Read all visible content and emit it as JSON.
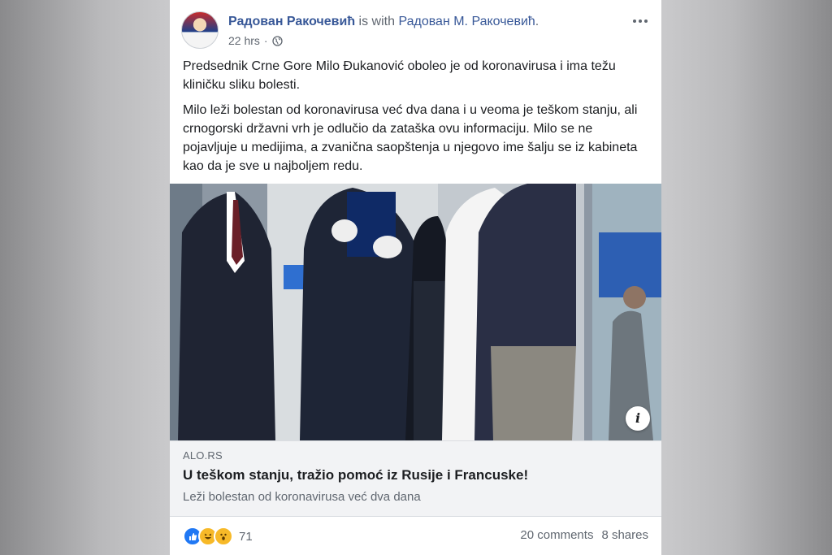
{
  "post": {
    "author": "Радован Ракочевић",
    "with_text": "is with",
    "tagged": "Радован М. Ракочевић",
    "time": "22 hrs",
    "separator": "·",
    "paragraphs": [
      "Predsednik Crne Gore Milo Đukanović oboleo je od koronavirusa i ima težu kliničku sliku bolesti.",
      "Milo leži bolestan od koronavirusa već dva dana i u veoma je teškom stanju, ali crnogorski državni vrh je odlučio da zataška ovu informaciju. Milo se ne pojavljuje u medijima, a zvanična saopštenja u njegovo ime šalju se iz kabineta kao da je sve u najboljem redu."
    ]
  },
  "link": {
    "source": "ALO.RS",
    "title": "U teškom stanju, tražio pomoć iz Rusije i Francuske!",
    "description": "Leži bolestan od koronavirusa već dva dana",
    "info_label": "i"
  },
  "footer": {
    "reaction_count": "71",
    "comments": "20 comments",
    "shares": "8 shares"
  },
  "icons": {
    "more": "more-options-icon",
    "privacy": "globe-icon",
    "reactions": [
      "like-icon",
      "haha-icon",
      "wow-icon"
    ]
  },
  "colors": {
    "link_blue": "#385898",
    "muted": "#606770",
    "like": "#2078f4",
    "emoji": "#f7b928"
  }
}
